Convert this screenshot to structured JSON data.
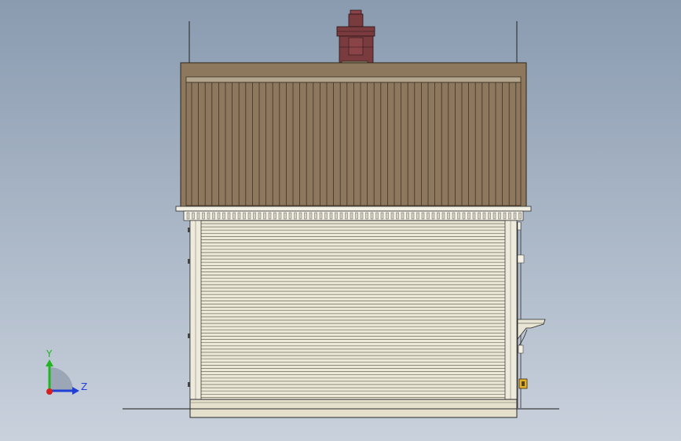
{
  "view": {
    "type": "cad-side-elevation",
    "background_top": "#8a9bb0",
    "background_bottom": "#c9d1dc"
  },
  "model": {
    "roof_color": "#8d775d",
    "roof_seam_color": "#3e3226",
    "chimney_color": "#7a3b3f",
    "siding_color": "#ece8d7",
    "siding_line_color": "#6e6a5c",
    "trim_color": "#f3f0e4",
    "foundation_color": "#e4e0cc"
  },
  "triad": {
    "y_label": "Y",
    "z_label": "Z",
    "y_color": "#21b521",
    "z_color": "#1f3fd6",
    "x_color": "#d42020"
  }
}
